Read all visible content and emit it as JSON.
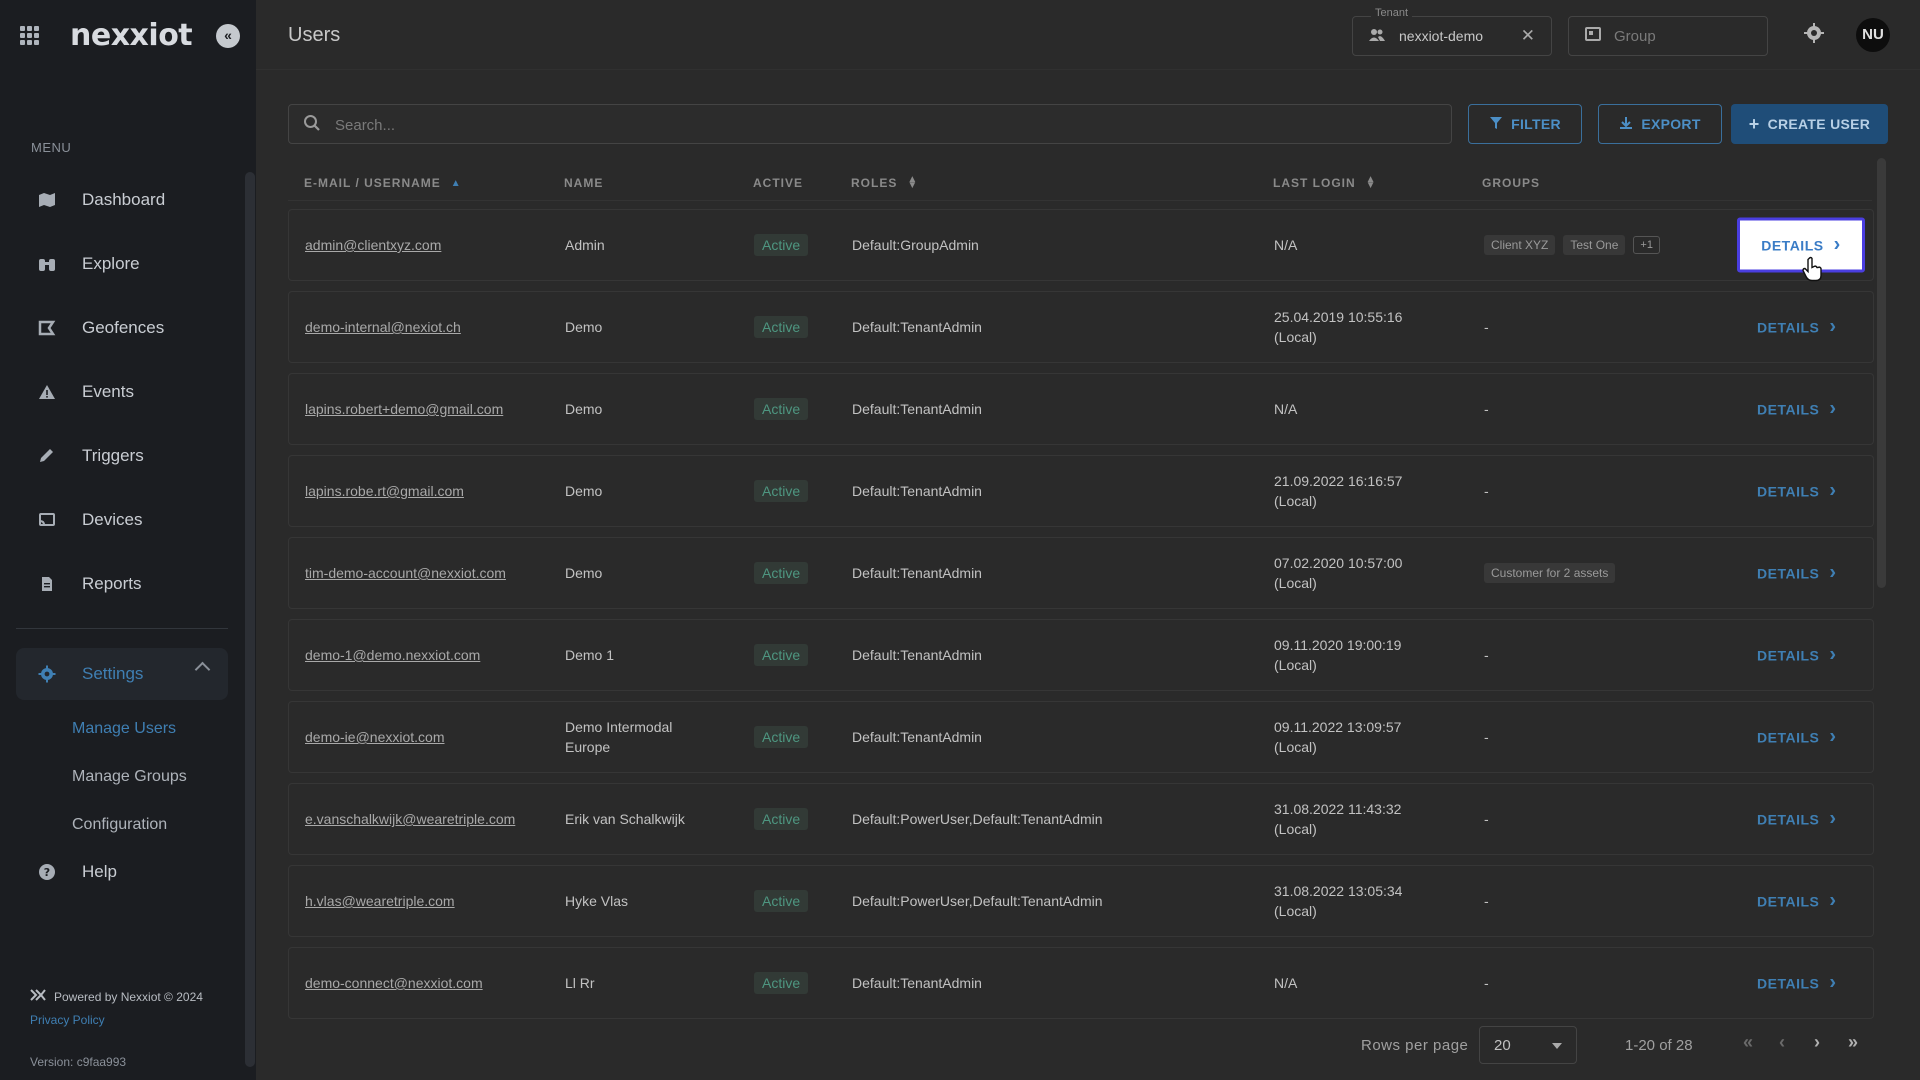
{
  "sidebar": {
    "logo": "nexxiot",
    "menu_label": "MENU",
    "items": [
      {
        "label": "Dashboard",
        "icon": "map-pin-icon"
      },
      {
        "label": "Explore",
        "icon": "binoculars-icon"
      },
      {
        "label": "Geofences",
        "icon": "geofence-icon"
      },
      {
        "label": "Events",
        "icon": "warning-icon"
      },
      {
        "label": "Triggers",
        "icon": "pencil-icon"
      },
      {
        "label": "Devices",
        "icon": "device-icon"
      },
      {
        "label": "Reports",
        "icon": "report-icon"
      }
    ],
    "settings": {
      "label": "Settings",
      "icon": "gear-icon"
    },
    "sub_items": [
      {
        "label": "Manage Users",
        "active": true
      },
      {
        "label": "Manage Groups",
        "active": false
      },
      {
        "label": "Configuration",
        "active": false
      }
    ],
    "help": {
      "label": "Help",
      "icon": "help-icon"
    },
    "powered_by": "Powered by Nexxiot © 2024",
    "privacy": "Privacy Policy",
    "version": "Version: c9faa993"
  },
  "header": {
    "title": "Users",
    "tenant_label": "Tenant",
    "tenant_value": "nexxiot-demo",
    "group_placeholder": "Group",
    "avatar": "NU"
  },
  "toolbar": {
    "search_placeholder": "Search...",
    "filter": "FILTER",
    "export": "EXPORT",
    "create": "CREATE USER"
  },
  "table": {
    "columns": {
      "email": "E-MAIL / USERNAME",
      "name": "NAME",
      "active": "ACTIVE",
      "roles": "ROLES",
      "last_login": "LAST LOGIN",
      "groups": "GROUPS"
    },
    "details_label": "DETAILS",
    "rows": [
      {
        "email": "admin@clientxyz.com",
        "name": "Admin",
        "active": "Active",
        "role": "Default:GroupAdmin",
        "login": "N/A",
        "groups": "",
        "tags": [
          "Client XYZ",
          "Test One"
        ],
        "more": "+1"
      },
      {
        "email": "demo-internal@nexiot.ch",
        "name": "Demo",
        "active": "Active",
        "role": "Default:TenantAdmin",
        "login": "25.04.2019 10:55:16\n(Local)",
        "groups": "-",
        "tags": [],
        "more": ""
      },
      {
        "email": "lapins.robert+demo@gmail.com",
        "name": "Demo",
        "active": "Active",
        "role": "Default:TenantAdmin",
        "login": "N/A",
        "groups": "-",
        "tags": [],
        "more": ""
      },
      {
        "email": "lapins.robe.rt@gmail.com",
        "name": "Demo",
        "active": "Active",
        "role": "Default:TenantAdmin",
        "login": "21.09.2022 16:16:57\n(Local)",
        "groups": "-",
        "tags": [],
        "more": ""
      },
      {
        "email": "tim-demo-account@nexxiot.com",
        "name": "Demo",
        "active": "Active",
        "role": "Default:TenantAdmin",
        "login": "07.02.2020 10:57:00\n(Local)",
        "groups": "",
        "tags": [
          "Customer for 2 assets"
        ],
        "more": ""
      },
      {
        "email": "demo-1@demo.nexxiot.com",
        "name": "Demo 1",
        "active": "Active",
        "role": "Default:TenantAdmin",
        "login": "09.11.2020 19:00:19\n(Local)",
        "groups": "-",
        "tags": [],
        "more": ""
      },
      {
        "email": "demo-ie@nexxiot.com",
        "name": "Demo Intermodal\nEurope",
        "active": "Active",
        "role": "Default:TenantAdmin",
        "login": "09.11.2022 13:09:57\n(Local)",
        "groups": "-",
        "tags": [],
        "more": ""
      },
      {
        "email": "e.vanschalkwijk@wearetriple.com",
        "name": "Erik van Schalkwijk",
        "active": "Active",
        "role": "Default:PowerUser,Default:TenantAdmin",
        "login": "31.08.2022 11:43:32\n(Local)",
        "groups": "-",
        "tags": [],
        "more": ""
      },
      {
        "email": "h.vlas@wearetriple.com",
        "name": "Hyke Vlas",
        "active": "Active",
        "role": "Default:PowerUser,Default:TenantAdmin",
        "login": "31.08.2022 13:05:34\n(Local)",
        "groups": "-",
        "tags": [],
        "more": ""
      },
      {
        "email": "demo-connect@nexxiot.com",
        "name": "Ll Rr",
        "active": "Active",
        "role": "Default:TenantAdmin",
        "login": "N/A",
        "groups": "-",
        "tags": [],
        "more": ""
      }
    ]
  },
  "pagination": {
    "rows_per_page_label": "Rows per page",
    "rows_per_page": "20",
    "range": "1-20 of 28"
  },
  "colors": {
    "accent": "#3f7fb3",
    "sidebar_bg": "#1b1d21",
    "active_badge": "#4e9680",
    "highlight_outline": "#4a3ee0"
  }
}
